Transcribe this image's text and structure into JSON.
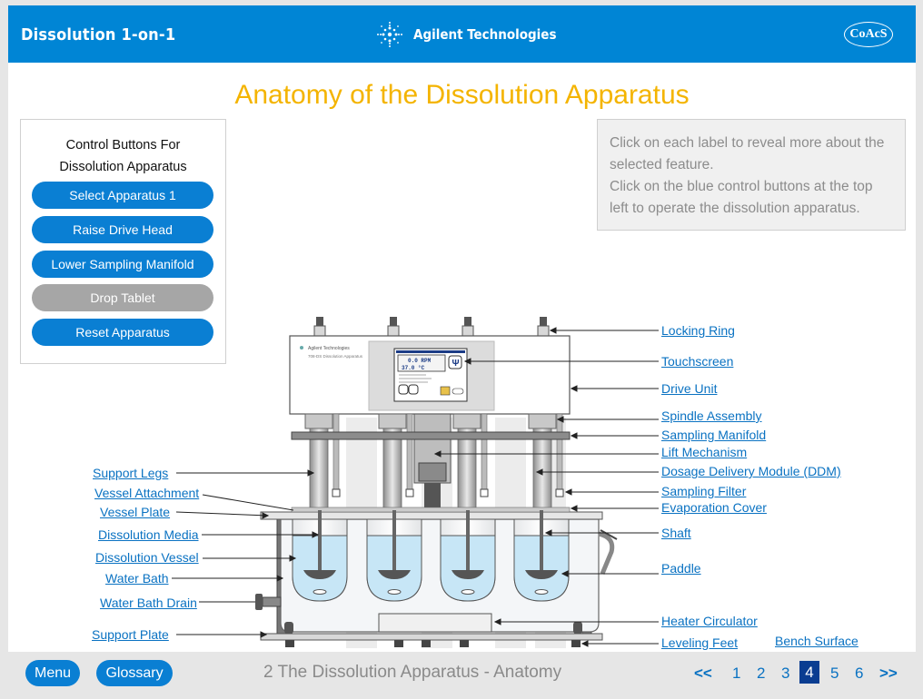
{
  "header": {
    "app_title": "Dissolution 1-on-1",
    "brand_name": "Agilent Technologies",
    "coacs_logo": "CoAcS"
  },
  "page": {
    "title": "Anatomy of the Dissolution Apparatus"
  },
  "controls": {
    "title_line1": "Control Buttons For",
    "title_line2": "Dissolution Apparatus",
    "buttons": [
      {
        "label": "Select Apparatus 1",
        "enabled": true
      },
      {
        "label": "Raise Drive Head",
        "enabled": true
      },
      {
        "label": "Lower Sampling Manifold",
        "enabled": true
      },
      {
        "label": "Drop Tablet",
        "enabled": false
      },
      {
        "label": "Reset Apparatus",
        "enabled": true
      }
    ]
  },
  "instructions": {
    "line1": "Click on each label to reveal more about the selected feature.",
    "line2": "Click on the blue control buttons at the top left to operate the dissolution apparatus."
  },
  "apparatus": {
    "brand": "Agilent Technologies",
    "model": "708-DS Dissolution Apparatus",
    "rpm": "0.0 RPM",
    "temp": "37.0 °C"
  },
  "labels_left": [
    "Support Legs",
    "Vessel Attachment",
    "Vessel Plate",
    "Dissolution Media",
    "Dissolution Vessel",
    "Water Bath",
    "Water Bath Drain",
    "Support Plate"
  ],
  "labels_right": [
    "Locking Ring",
    "Touchscreen",
    "Drive Unit",
    "Spindle Assembly",
    "Sampling Manifold",
    "Lift Mechanism",
    "Dosage Delivery Module (DDM)",
    "Sampling Filter",
    "Evaporation Cover",
    "Shaft",
    "Paddle",
    "Heater Circulator",
    "Leveling Feet",
    "Bench Surface"
  ],
  "footer": {
    "menu": "Menu",
    "glossary": "Glossary",
    "section": "2 The Dissolution Apparatus - Anatomy",
    "prev": "<<",
    "next": ">>",
    "pages": [
      "1",
      "2",
      "3",
      "4",
      "5",
      "6"
    ],
    "current_page": "4"
  },
  "colors": {
    "primary": "#0085d5",
    "button": "#0a7fd3",
    "title": "#f4b400",
    "link": "#0a72c2",
    "disabled": "#a6a6a6"
  }
}
